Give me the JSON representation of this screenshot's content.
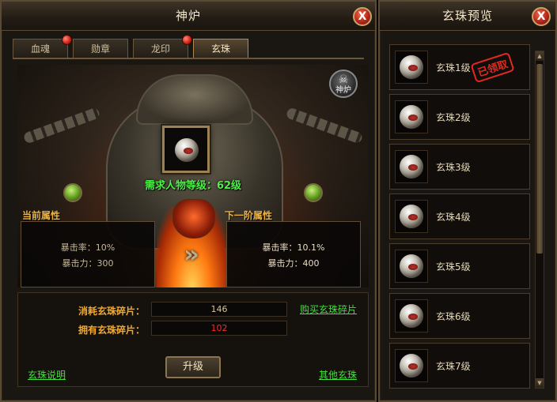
{
  "left_panel": {
    "title": "神炉",
    "close_label": "X",
    "tabs": [
      {
        "label": "血魂",
        "has_dot": true
      },
      {
        "label": "勋章",
        "has_dot": false
      },
      {
        "label": "龙印",
        "has_dot": true
      },
      {
        "label": "玄珠",
        "has_dot": false,
        "active": true
      }
    ],
    "brazier_label": "神炉",
    "required_level": "需求人物等级：62级",
    "current_attr": {
      "title": "当前属性",
      "crit_rate": "暴击率：10%",
      "crit_power": "暴击力：300"
    },
    "next_attr": {
      "title": "下一阶属性",
      "crit_rate": "暴击率：10.1%",
      "crit_power": "暴击力：400"
    },
    "cost_label": "消耗玄珠碎片：",
    "cost_value": "146",
    "own_label": "拥有玄珠碎片：",
    "own_value": "102",
    "buy_link": "购买玄珠碎片",
    "upgrade_label": "升级",
    "help_link": "玄珠说明",
    "other_link": "其他玄珠",
    "colors": {
      "cost_value": "#d2c39d",
      "own_value": "#ff2a20",
      "level_text": "#4ff04a",
      "link": "#3fe03a"
    }
  },
  "right_panel": {
    "title": "玄珠预览",
    "close_label": "X",
    "items": [
      {
        "name": "玄珠1级",
        "stamp": "已领取"
      },
      {
        "name": "玄珠2级"
      },
      {
        "name": "玄珠3级"
      },
      {
        "name": "玄珠4级"
      },
      {
        "name": "玄珠5级"
      },
      {
        "name": "玄珠6级"
      },
      {
        "name": "玄珠7级"
      }
    ]
  }
}
